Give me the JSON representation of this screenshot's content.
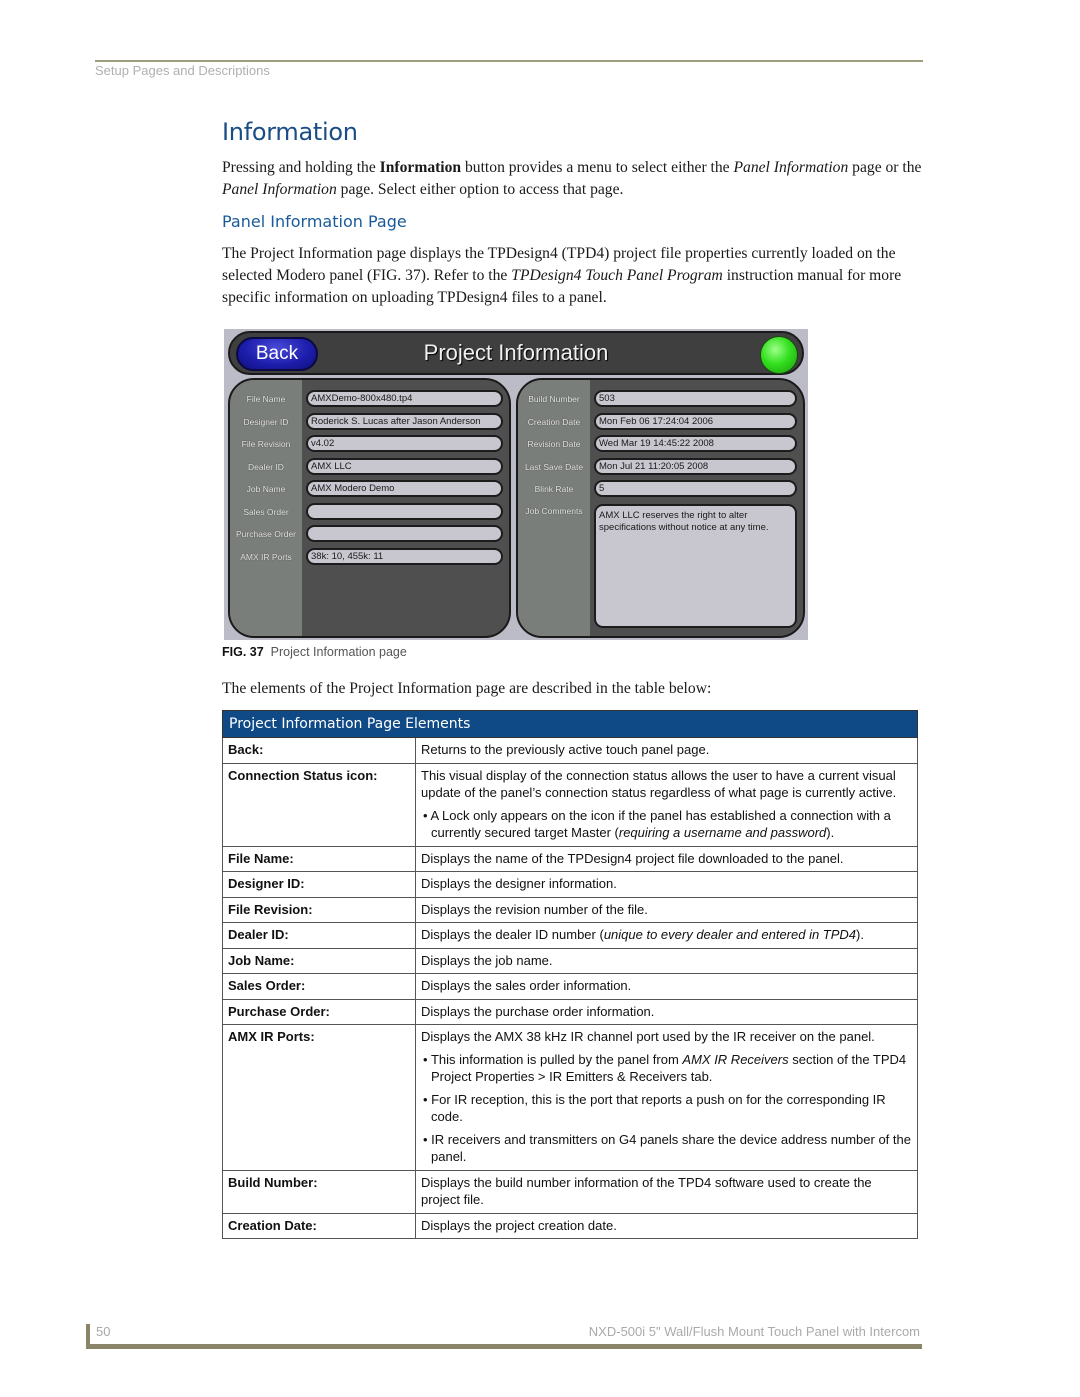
{
  "header": {
    "running_head": "Setup Pages and Descriptions"
  },
  "section": {
    "title": "Information",
    "intro": [
      {
        "t": "Pressing and holding the ",
        "s": "n"
      },
      {
        "t": "Information",
        "s": "b"
      },
      {
        "t": " button provides a menu to select either the ",
        "s": "n"
      },
      {
        "t": "Panel Information",
        "s": "i"
      },
      {
        "t": " page or the ",
        "s": "n"
      },
      {
        "t": "Panel Information",
        "s": "i"
      },
      {
        "t": " page. Select either option to access that page.",
        "s": "n"
      }
    ],
    "subtitle": "Panel Information Page",
    "body": [
      {
        "t": "The Project Information page displays the TPDesign4 (TPD4) project file properties currently loaded on the selected Modero panel (FIG. 37). Refer to the ",
        "s": "n"
      },
      {
        "t": "TPDesign4 Touch Panel Program",
        "s": "i"
      },
      {
        "t": " instruction manual for more specific information on uploading TPDesign4 files to a panel.",
        "s": "n"
      }
    ]
  },
  "panel": {
    "back_label": "Back",
    "title": "Project Information",
    "status_icon": "connection-status-led",
    "status_color": "#34e020",
    "left_fields": [
      {
        "label": "File Name",
        "value": "AMXDemo-800x480.tp4"
      },
      {
        "label": "Designer ID",
        "value": "Roderick S. Lucas after Jason Anderson"
      },
      {
        "label": "File Revision",
        "value": "v4.02"
      },
      {
        "label": "Dealer ID",
        "value": "AMX LLC"
      },
      {
        "label": "Job Name",
        "value": "AMX Modero Demo"
      },
      {
        "label": "Sales Order",
        "value": ""
      },
      {
        "label": "Purchase Order",
        "value": ""
      },
      {
        "label": "AMX IR Ports",
        "value": "38k: 10, 455k: 11"
      }
    ],
    "right_fields": [
      {
        "label": "Build Number",
        "value": "503"
      },
      {
        "label": "Creation Date",
        "value": "Mon Feb 06 17:24:04 2006"
      },
      {
        "label": "Revision Date",
        "value": "Wed Mar 19 14:45:22 2008"
      },
      {
        "label": "Last Save Date",
        "value": "Mon Jul 21 11:20:05 2008"
      },
      {
        "label": "Blink Rate",
        "value": "5"
      }
    ],
    "comments_label": "Job Comments",
    "comments_value": "AMX LLC reserves the right to alter specifications without notice at any time."
  },
  "figure": {
    "number": "FIG. 37",
    "caption": "Project Information page"
  },
  "table_intro": "The elements of the Project Information page are described in the table below:",
  "table": {
    "title": "Project Information Page Elements",
    "rows": [
      {
        "term": "Back:",
        "desc": [
          [
            {
              "t": "Returns to the previously active touch panel page.",
              "s": "n"
            }
          ]
        ],
        "bullets": []
      },
      {
        "term": "Connection Status icon:",
        "desc": [
          [
            {
              "t": "This visual display of the connection status allows the user to have a current visual update of the panel’s connection status regardless of what page is currently active.",
              "s": "n"
            }
          ]
        ],
        "bullets": [
          [
            {
              "t": "A Lock only appears on the icon if the panel has established a connection with a currently secured target Master (",
              "s": "n"
            },
            {
              "t": "requiring a username and password",
              "s": "i"
            },
            {
              "t": ").",
              "s": "n"
            }
          ]
        ]
      },
      {
        "term": "File Name:",
        "desc": [
          [
            {
              "t": "Displays the name of the TPDesign4 project file downloaded to the panel.",
              "s": "n"
            }
          ]
        ],
        "bullets": []
      },
      {
        "term": "Designer ID:",
        "desc": [
          [
            {
              "t": "Displays the designer information.",
              "s": "n"
            }
          ]
        ],
        "bullets": []
      },
      {
        "term": "File Revision:",
        "desc": [
          [
            {
              "t": "Displays the revision number of the file.",
              "s": "n"
            }
          ]
        ],
        "bullets": []
      },
      {
        "term": "Dealer ID:",
        "desc": [
          [
            {
              "t": "Displays the dealer ID number (",
              "s": "n"
            },
            {
              "t": "unique to every dealer and entered in TPD4",
              "s": "i"
            },
            {
              "t": ").",
              "s": "n"
            }
          ]
        ],
        "bullets": []
      },
      {
        "term": "Job Name:",
        "desc": [
          [
            {
              "t": "Displays the job name.",
              "s": "n"
            }
          ]
        ],
        "bullets": []
      },
      {
        "term": "Sales Order:",
        "desc": [
          [
            {
              "t": "Displays the sales order information.",
              "s": "n"
            }
          ]
        ],
        "bullets": []
      },
      {
        "term": "Purchase Order:",
        "desc": [
          [
            {
              "t": "Displays the purchase order information.",
              "s": "n"
            }
          ]
        ],
        "bullets": []
      },
      {
        "term": "AMX IR Ports:",
        "desc": [
          [
            {
              "t": "Displays the AMX 38 kHz IR channel port used by the IR receiver on the panel.",
              "s": "n"
            }
          ]
        ],
        "bullets": [
          [
            {
              "t": "This information is pulled by the panel from ",
              "s": "n"
            },
            {
              "t": "AMX IR Receivers",
              "s": "i"
            },
            {
              "t": " section of the TPD4 Project Properties > IR Emitters & Receivers tab.",
              "s": "n"
            }
          ],
          [
            {
              "t": "For IR reception, this is the port that reports a push on for the corresponding IR code.",
              "s": "n"
            }
          ],
          [
            {
              "t": "IR receivers and transmitters on G4 panels share the device address number of the panel.",
              "s": "n"
            }
          ]
        ]
      },
      {
        "term": "Build Number:",
        "desc": [
          [
            {
              "t": "Displays the build number information of the TPD4 software used to create the project file.",
              "s": "n"
            }
          ]
        ],
        "bullets": []
      },
      {
        "term": "Creation Date:",
        "desc": [
          [
            {
              "t": "Displays the project creation date.",
              "s": "n"
            }
          ]
        ],
        "bullets": []
      }
    ]
  },
  "footer": {
    "page_number": "50",
    "doc_title": "NXD-500i 5\" Wall/Flush Mount Touch Panel with Intercom"
  }
}
